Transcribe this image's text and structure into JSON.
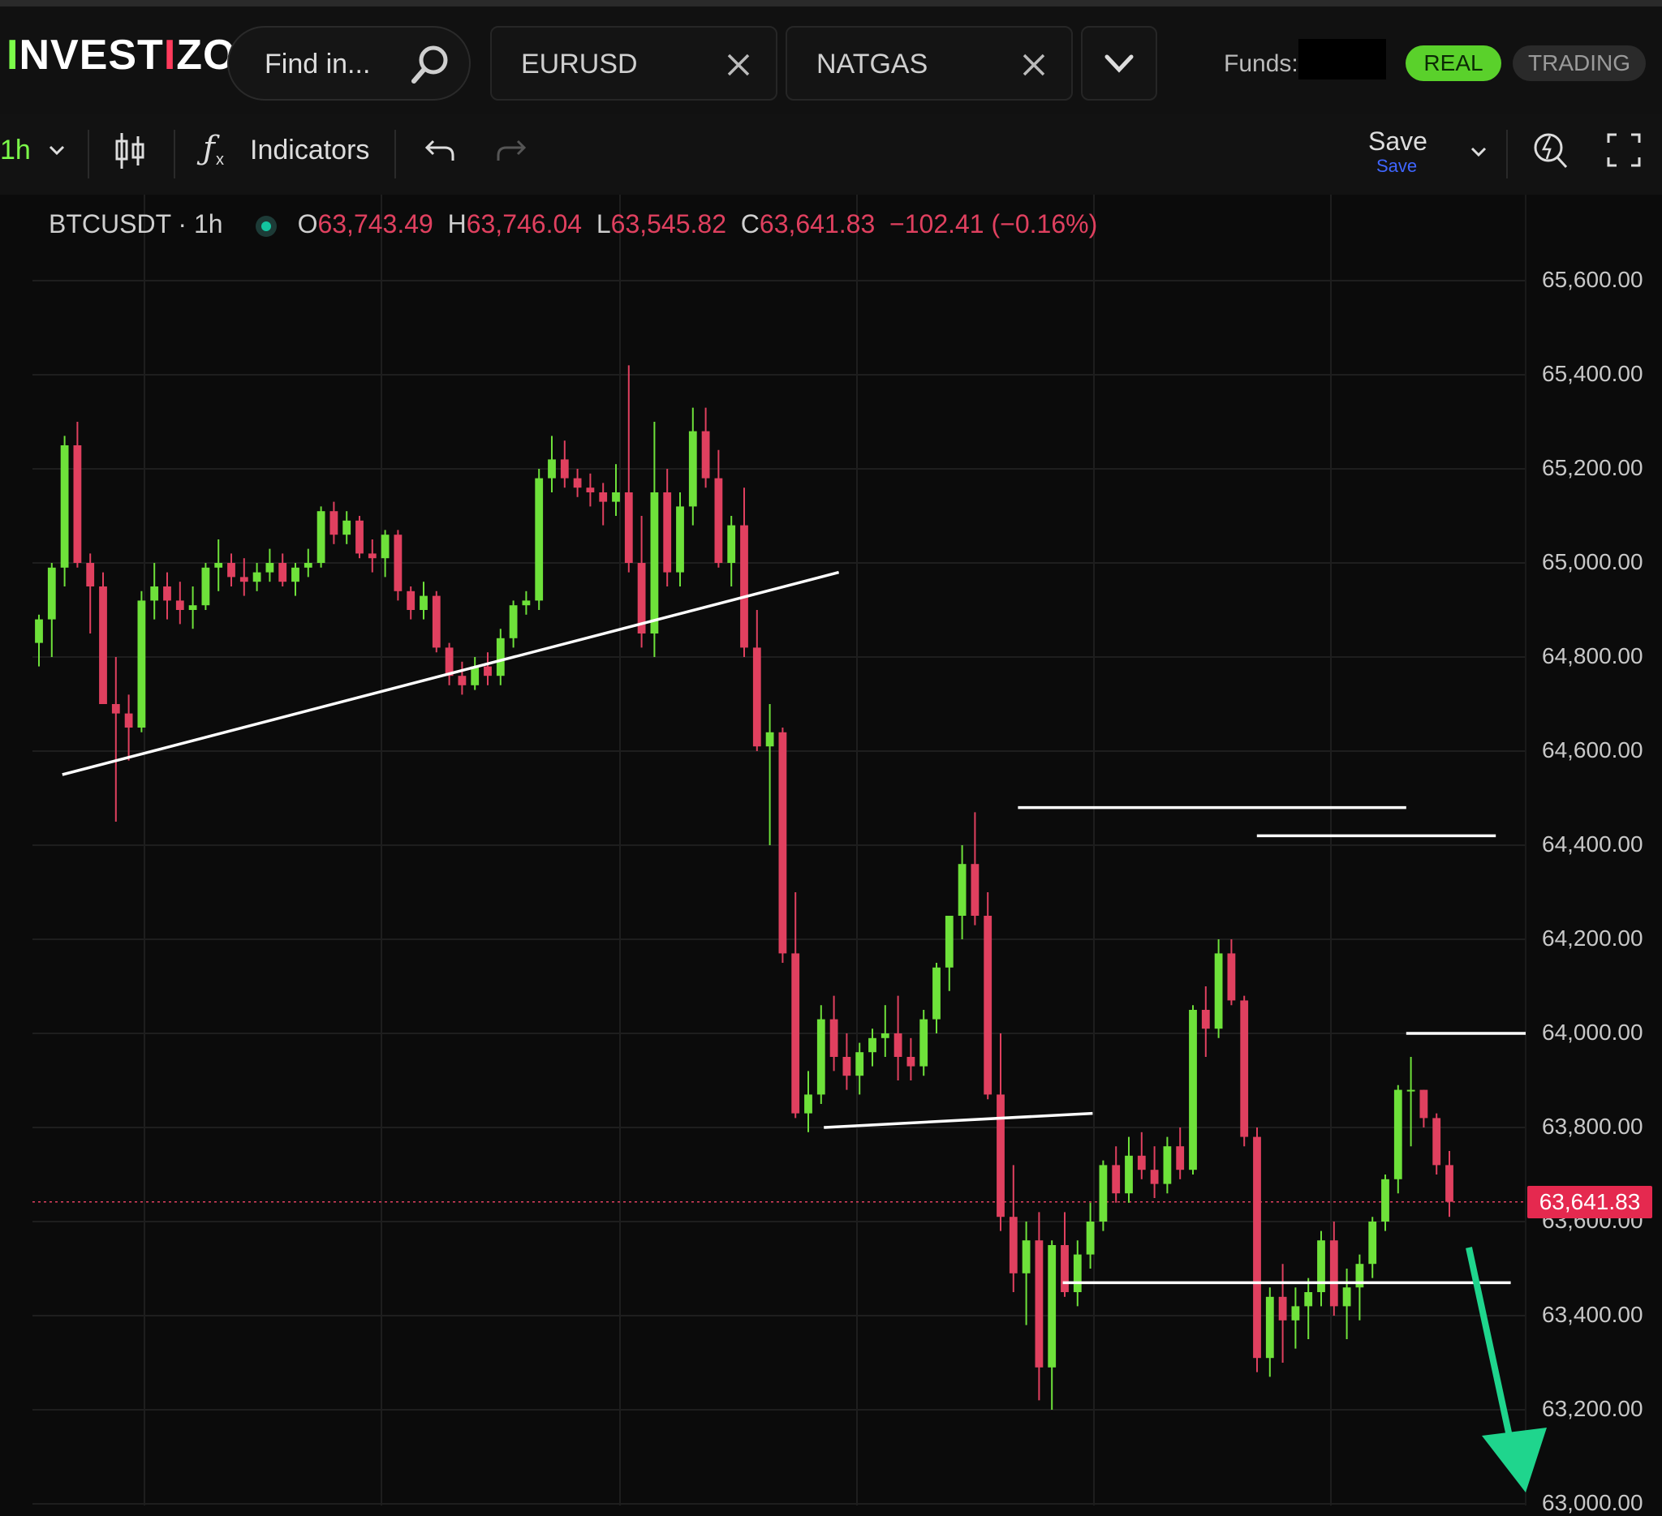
{
  "header": {
    "logo": {
      "prefix": "I",
      "mid1": "NVEST",
      "mid2": "I",
      "suffix": "ZO"
    },
    "search_placeholder": "Find in...",
    "tabs": [
      {
        "label": "EURUSD"
      },
      {
        "label": "NATGAS"
      }
    ],
    "funds_label": "Funds:",
    "mode_real": "REAL",
    "mode_trading": "TRADING"
  },
  "toolbar": {
    "interval": "1h",
    "indicators": "Indicators",
    "save_main": "Save",
    "save_sub": "Save"
  },
  "symbol": {
    "name": "BTCUSDT · 1h",
    "open_key": "O",
    "open": "63,743.49",
    "high_key": "H",
    "high": "63,746.04",
    "low_key": "L",
    "low": "63,545.82",
    "close_key": "C",
    "close": "63,641.83",
    "change": "−102.41 (−0.16%)"
  },
  "price_axis": [
    "65,600.00",
    "65,400.00",
    "65,200.00",
    "65,000.00",
    "64,800.00",
    "64,600.00",
    "64,400.00",
    "64,200.00",
    "64,000.00",
    "63,800.00",
    "63,600.00",
    "63,400.00",
    "63,200.00",
    "63,000.00"
  ],
  "current_price": "63,641.83",
  "colors": {
    "up": "#6ee13a",
    "down": "#e0405f",
    "bg": "#0b0b0b",
    "grid": "#1e1e1e",
    "arrow": "#1fd58d"
  },
  "chart_data": {
    "type": "candlestick",
    "symbol": "BTCUSDT",
    "interval": "1h",
    "ylim": [
      63000,
      65700
    ],
    "candles": [
      [
        64830,
        64890,
        64780,
        64880
      ],
      [
        64880,
        65000,
        64800,
        64990
      ],
      [
        64990,
        65270,
        64950,
        65250
      ],
      [
        65250,
        65300,
        64990,
        65000
      ],
      [
        65000,
        65020,
        64850,
        64950
      ],
      [
        64950,
        64980,
        64700,
        64700
      ],
      [
        64700,
        64800,
        64450,
        64680
      ],
      [
        64680,
        64720,
        64580,
        64650
      ],
      [
        64650,
        64940,
        64640,
        64920
      ],
      [
        64920,
        65000,
        64880,
        64950
      ],
      [
        64950,
        64980,
        64880,
        64920
      ],
      [
        64920,
        64960,
        64870,
        64900
      ],
      [
        64900,
        64950,
        64860,
        64910
      ],
      [
        64910,
        65000,
        64900,
        64990
      ],
      [
        64990,
        65050,
        64940,
        65000
      ],
      [
        65000,
        65020,
        64950,
        64970
      ],
      [
        64970,
        65010,
        64930,
        64960
      ],
      [
        64960,
        65000,
        64940,
        64980
      ],
      [
        64980,
        65030,
        64960,
        65000
      ],
      [
        65000,
        65020,
        64950,
        64960
      ],
      [
        64960,
        65000,
        64930,
        64990
      ],
      [
        64990,
        65030,
        64970,
        65000
      ],
      [
        65000,
        65120,
        64990,
        65110
      ],
      [
        65110,
        65130,
        65040,
        65060
      ],
      [
        65060,
        65110,
        65040,
        65090
      ],
      [
        65090,
        65100,
        65010,
        65020
      ],
      [
        65020,
        65050,
        64980,
        65010
      ],
      [
        65010,
        65070,
        64970,
        65060
      ],
      [
        65060,
        65070,
        64920,
        64940
      ],
      [
        64940,
        64950,
        64880,
        64900
      ],
      [
        64900,
        64960,
        64880,
        64930
      ],
      [
        64930,
        64940,
        64810,
        64820
      ],
      [
        64820,
        64830,
        64740,
        64760
      ],
      [
        64760,
        64790,
        64720,
        64740
      ],
      [
        64740,
        64800,
        64730,
        64780
      ],
      [
        64780,
        64810,
        64740,
        64760
      ],
      [
        64760,
        64860,
        64740,
        64840
      ],
      [
        64840,
        64920,
        64820,
        64910
      ],
      [
        64910,
        64940,
        64890,
        64920
      ],
      [
        64920,
        65200,
        64900,
        65180
      ],
      [
        65180,
        65270,
        65150,
        65220
      ],
      [
        65220,
        65260,
        65160,
        65180
      ],
      [
        65180,
        65200,
        65140,
        65160
      ],
      [
        65160,
        65190,
        65120,
        65150
      ],
      [
        65150,
        65170,
        65080,
        65130
      ],
      [
        65130,
        65210,
        65100,
        65150
      ],
      [
        65150,
        65420,
        64980,
        65000
      ],
      [
        65000,
        65100,
        64820,
        64850
      ],
      [
        64850,
        65300,
        64800,
        65150
      ],
      [
        65150,
        65200,
        64950,
        64980
      ],
      [
        64980,
        65150,
        64950,
        65120
      ],
      [
        65120,
        65330,
        65080,
        65280
      ],
      [
        65280,
        65330,
        65160,
        65180
      ],
      [
        65180,
        65240,
        64990,
        65000
      ],
      [
        65000,
        65100,
        64950,
        65080
      ],
      [
        65080,
        65160,
        64800,
        64820
      ],
      [
        64820,
        64900,
        64600,
        64610
      ],
      [
        64610,
        64700,
        64400,
        64640
      ],
      [
        64640,
        64650,
        64150,
        64170
      ],
      [
        64170,
        64300,
        63820,
        63830
      ],
      [
        63830,
        63920,
        63790,
        63870
      ],
      [
        63870,
        64060,
        63850,
        64030
      ],
      [
        64030,
        64080,
        63920,
        63950
      ],
      [
        63950,
        64000,
        63880,
        63910
      ],
      [
        63910,
        63980,
        63870,
        63960
      ],
      [
        63960,
        64010,
        63930,
        63990
      ],
      [
        63990,
        64060,
        63950,
        64000
      ],
      [
        64000,
        64080,
        63900,
        63950
      ],
      [
        63950,
        63990,
        63900,
        63930
      ],
      [
        63930,
        64050,
        63910,
        64030
      ],
      [
        64030,
        64150,
        64000,
        64140
      ],
      [
        64140,
        64250,
        64090,
        64250
      ],
      [
        64250,
        64400,
        64200,
        64360
      ],
      [
        64360,
        64470,
        64230,
        64250
      ],
      [
        64250,
        64300,
        63860,
        63870
      ],
      [
        63870,
        64000,
        63580,
        63610
      ],
      [
        63610,
        63720,
        63450,
        63490
      ],
      [
        63490,
        63600,
        63380,
        63560
      ],
      [
        63560,
        63620,
        63220,
        63290
      ],
      [
        63290,
        63560,
        63200,
        63550
      ],
      [
        63550,
        63620,
        63440,
        63450
      ],
      [
        63450,
        63560,
        63420,
        63530
      ],
      [
        63530,
        63640,
        63500,
        63600
      ],
      [
        63600,
        63730,
        63580,
        63720
      ],
      [
        63720,
        63760,
        63640,
        63660
      ],
      [
        63660,
        63780,
        63640,
        63740
      ],
      [
        63740,
        63790,
        63690,
        63710
      ],
      [
        63710,
        63760,
        63650,
        63680
      ],
      [
        63680,
        63780,
        63660,
        63760
      ],
      [
        63760,
        63800,
        63690,
        63710
      ],
      [
        63710,
        64060,
        63700,
        64050
      ],
      [
        64050,
        64100,
        63950,
        64010
      ],
      [
        64010,
        64200,
        63990,
        64170
      ],
      [
        64170,
        64200,
        64060,
        64070
      ],
      [
        64070,
        64080,
        63760,
        63780
      ],
      [
        63780,
        63800,
        63280,
        63310
      ],
      [
        63310,
        63460,
        63270,
        63440
      ],
      [
        63440,
        63510,
        63300,
        63390
      ],
      [
        63390,
        63460,
        63330,
        63420
      ],
      [
        63420,
        63480,
        63350,
        63450
      ],
      [
        63450,
        63580,
        63420,
        63560
      ],
      [
        63560,
        63600,
        63400,
        63420
      ],
      [
        63420,
        63500,
        63350,
        63460
      ],
      [
        63460,
        63530,
        63390,
        63510
      ],
      [
        63510,
        63610,
        63480,
        63600
      ],
      [
        63600,
        63700,
        63580,
        63690
      ],
      [
        63690,
        63890,
        63660,
        63880
      ],
      [
        63880,
        63950,
        63760,
        63880
      ],
      [
        63880,
        63880,
        63800,
        63820
      ],
      [
        63820,
        63830,
        63700,
        63720
      ],
      [
        63720,
        63750,
        63610,
        63642
      ]
    ],
    "annotations": [
      {
        "type": "trendline",
        "from": [
          0.02,
          64550
        ],
        "to": [
          0.54,
          64980
        ]
      },
      {
        "type": "horizontal",
        "price": 64480,
        "range": [
          0.66,
          0.92
        ]
      },
      {
        "type": "horizontal",
        "price": 64420,
        "range": [
          0.82,
          0.98
        ]
      },
      {
        "type": "trendline",
        "from": [
          0.53,
          63800
        ],
        "to": [
          0.71,
          63830
        ]
      },
      {
        "type": "horizontal",
        "price": 64000,
        "range": [
          0.92,
          1.0
        ]
      },
      {
        "type": "horizontal",
        "price": 63470,
        "range": [
          0.69,
          0.99
        ]
      },
      {
        "type": "arrow",
        "direction": "down"
      }
    ]
  }
}
